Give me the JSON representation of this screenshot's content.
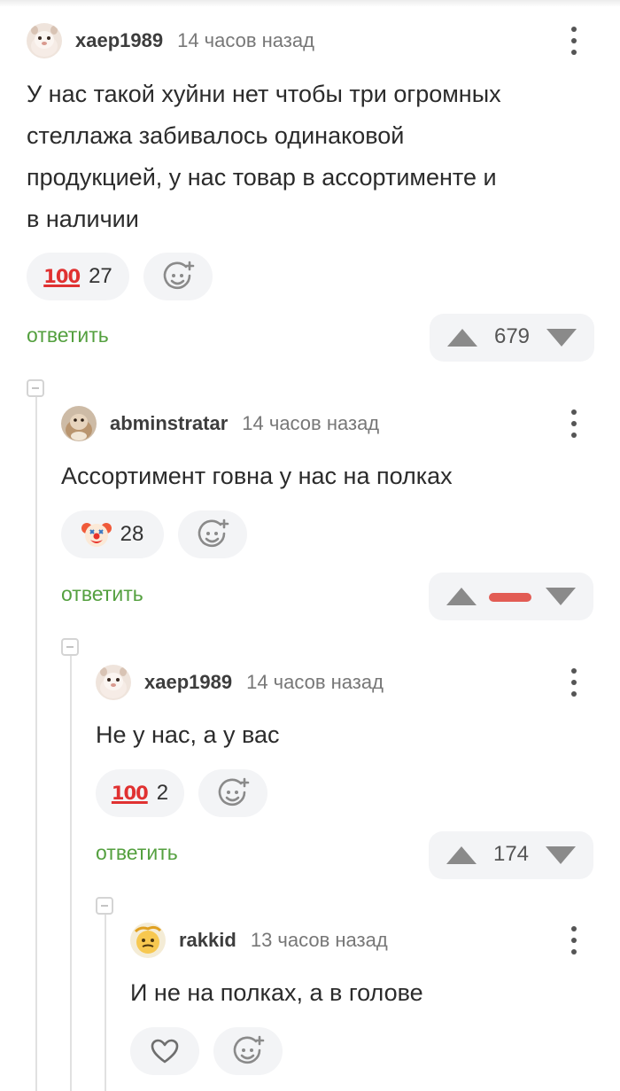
{
  "comments": [
    {
      "username": "xaep1989",
      "time": "14 часов назад",
      "text_lines": [
        "У нас такой хуйни нет чтобы три огромных",
        "стеллажа забивалось одинаковой",
        "продукцией, у нас товар в ассортименте и",
        "в наличии"
      ],
      "reaction_emoji": "100",
      "reaction_count": "27",
      "reply_label": "ответить",
      "rating": "679"
    },
    {
      "username": "abminstratar",
      "time": "14 часов назад",
      "text_lines": [
        "Ассортимент говна у нас на полках"
      ],
      "reaction_emoji": "clown-face",
      "reaction_count": "28",
      "reply_label": "ответить",
      "rating": "",
      "rating_negative": true
    },
    {
      "username": "xaep1989",
      "time": "14 часов назад",
      "text_lines": [
        "Не у нас, а у вас"
      ],
      "reaction_emoji": "100",
      "reaction_count": "2",
      "reply_label": "ответить",
      "rating": "174"
    },
    {
      "username": "rakkid",
      "time": "13 часов назад",
      "text_lines": [
        "И не на полках, а в голове"
      ],
      "reaction_emoji": "heart-outline",
      "reaction_count": ""
    }
  ],
  "icons": {
    "add_reaction": "smiley-plus-icon",
    "menu": "kebab-menu-icon",
    "upvote": "triangle-up-icon",
    "downvote": "triangle-down-icon",
    "collapse": "collapse-thread-icon"
  },
  "colors": {
    "reply_link": "#54a03f",
    "negative_rating": "#e25c54",
    "reaction_100": "#e03131"
  }
}
